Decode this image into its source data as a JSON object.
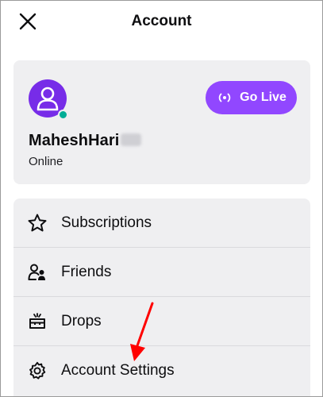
{
  "header": {
    "title": "Account",
    "close_icon": "close-icon"
  },
  "profile": {
    "username": "MaheshHari",
    "status": "Online",
    "status_color": "#00ad96",
    "avatar_color": "#772ce8",
    "go_live_label": "Go Live",
    "go_live_color": "#9147ff"
  },
  "menu": {
    "items": [
      {
        "label": "Subscriptions",
        "icon": "star-icon"
      },
      {
        "label": "Friends",
        "icon": "friends-icon"
      },
      {
        "label": "Drops",
        "icon": "drops-icon"
      },
      {
        "label": "Account Settings",
        "icon": "gear-icon"
      }
    ]
  },
  "annotation": {
    "color": "#ff0000"
  }
}
